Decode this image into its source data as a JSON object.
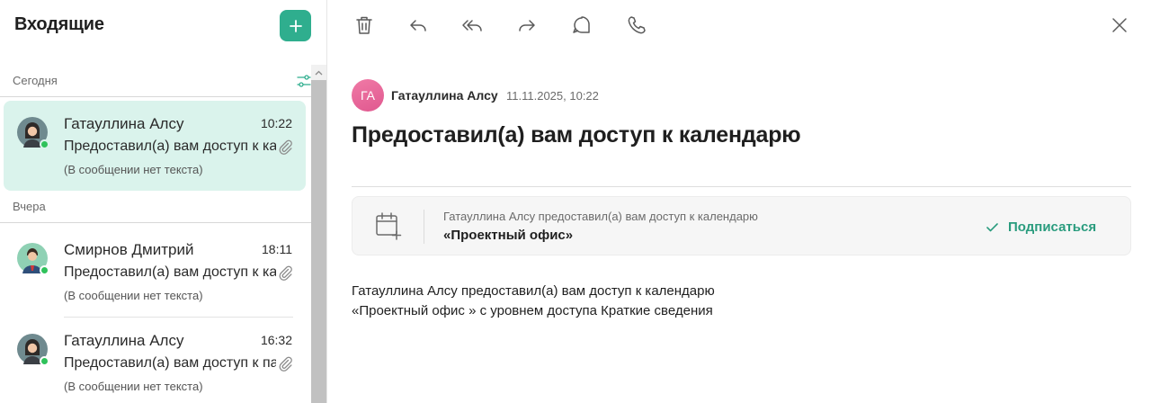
{
  "sidebar": {
    "title": "Входящие",
    "groups": [
      {
        "label": "Сегодня",
        "items": [
          {
            "sender": "Гатауллина Алсу",
            "time": "10:22",
            "subject": "Предоставил(а) вам доступ к календарю",
            "preview": "(В сообщении нет текста)",
            "selected": true
          }
        ]
      },
      {
        "label": "Вчера",
        "items": [
          {
            "sender": "Смирнов Дмитрий",
            "time": "18:11",
            "subject": "Предоставил(а) вам доступ к календарю",
            "preview": "(В сообщении нет текста)",
            "selected": false
          },
          {
            "sender": "Гатауллина Алсу",
            "time": "16:32",
            "subject": "Предоставил(а) вам доступ к папке",
            "preview": "(В сообщении нет текста)",
            "selected": false
          }
        ]
      }
    ]
  },
  "toolbar": {
    "icons": [
      "trash-icon",
      "reply-icon",
      "reply-all-icon",
      "forward-icon",
      "chat-icon",
      "phone-icon",
      "close-icon"
    ]
  },
  "message": {
    "avatar_initials": "ГА",
    "sender": "Гатауллина Алсу",
    "date": "11.11.2025, 10:22",
    "subject": "Предоставил(а) вам доступ к календарю",
    "invite": {
      "line1": "Гатауллина Алсу предоставил(а) вам доступ к календарю",
      "line2": "«Проектный офис»",
      "action": "Подписаться"
    },
    "body_line1": "Гатауллина Алсу предоставил(а) вам доступ к календарю",
    "body_line2": "«Проектный офис » с уровнем доступа Краткие сведения"
  },
  "colors": {
    "accent": "#2fae8e",
    "selected_bg": "#daf3ec",
    "online": "#2fc25b",
    "avatar_pink": "#e0588f"
  }
}
